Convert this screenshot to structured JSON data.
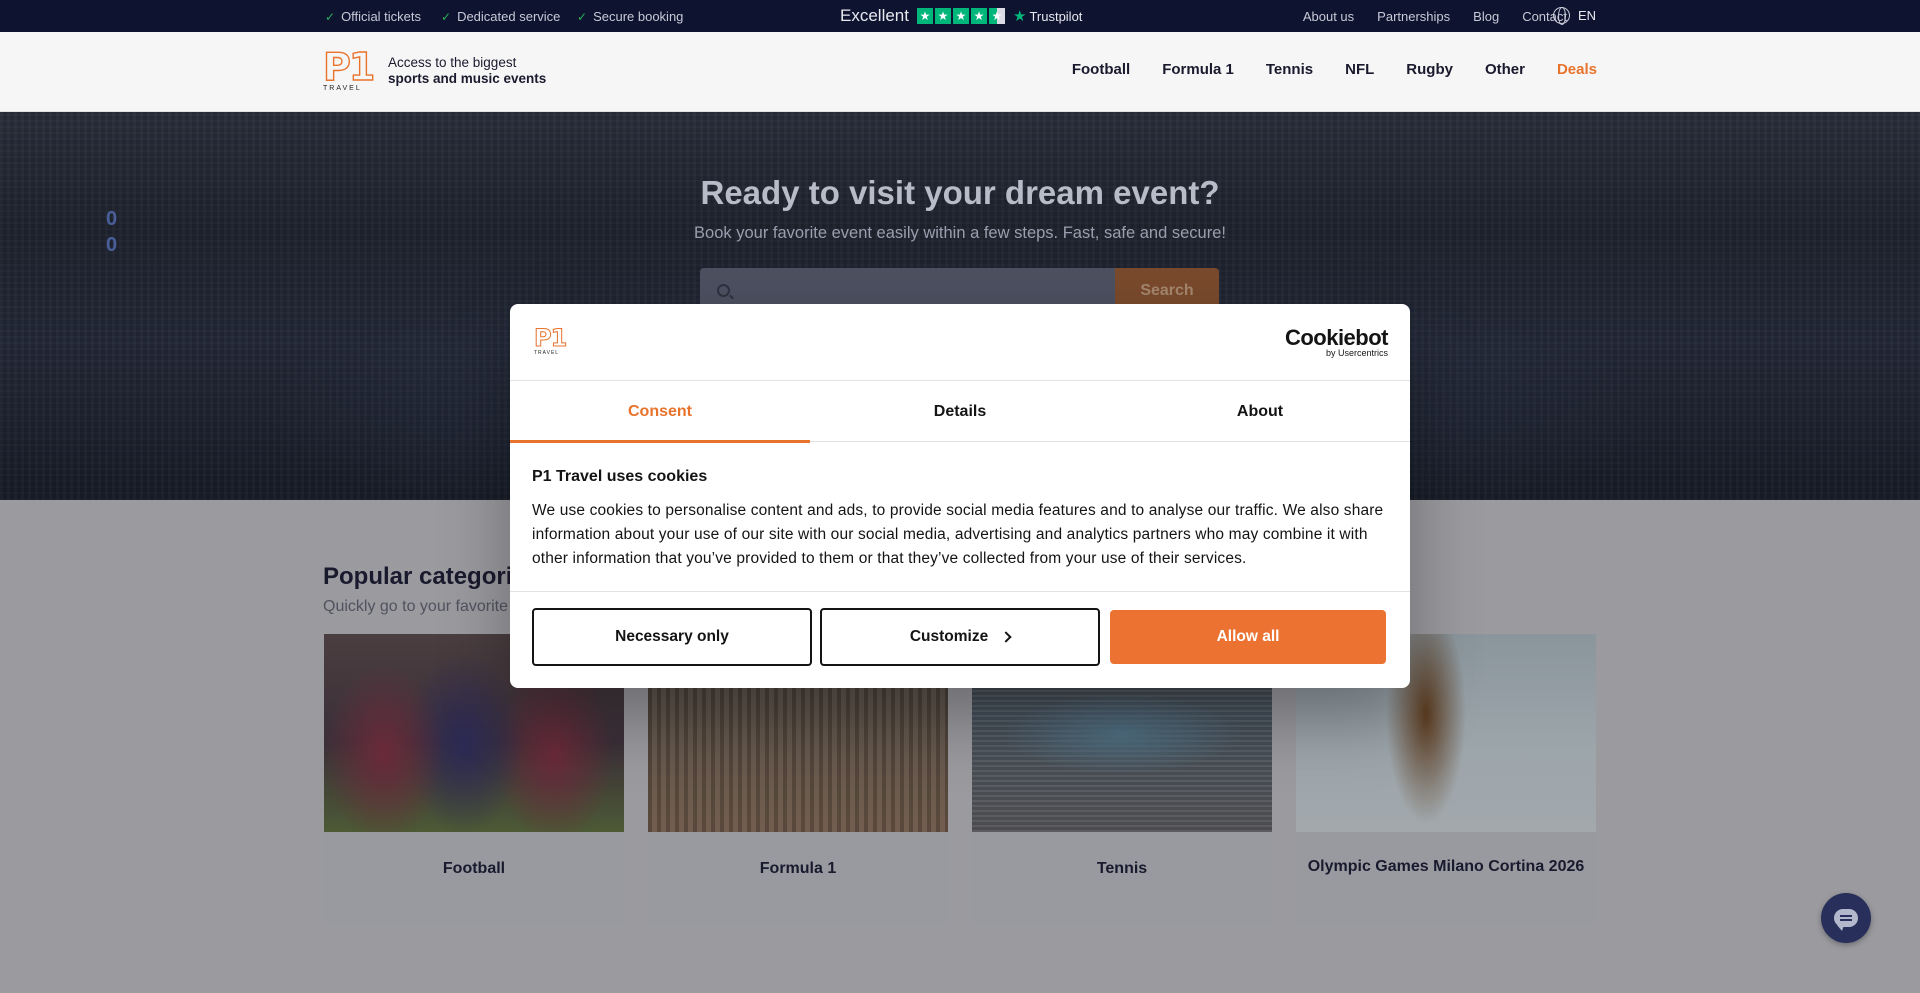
{
  "topbar": {
    "usps": [
      "Official tickets",
      "Dedicated service",
      "Secure booking"
    ],
    "trustpilot": {
      "rating_text": "Excellent",
      "brand": "Trustpilot",
      "stars": 4.5
    },
    "links": [
      "About us",
      "Partnerships",
      "Blog",
      "Contact"
    ],
    "language": "EN"
  },
  "header": {
    "logo_text": "P1",
    "logo_sub": "TRAVEL",
    "tagline_line1": "Access to the biggest",
    "tagline_line2": "sports and music events",
    "nav": [
      "Football",
      "Formula 1",
      "Tennis",
      "NFL",
      "Rugby",
      "Other",
      "Deals"
    ]
  },
  "hero": {
    "title": "Ready to visit your dream event?",
    "subtitle": "Book your favorite event easily within a few steps. Fast, safe and secure!",
    "search_placeholder": "",
    "search_button": "Search",
    "scoreboard": [
      "0",
      "0"
    ]
  },
  "categories": {
    "title": "Popular categories",
    "subtitle": "Quickly go to your favorite",
    "cards": [
      "Football",
      "Formula 1",
      "Tennis",
      "Olympic Games Milano Cortina 2026"
    ]
  },
  "cookie_dialog": {
    "provider": "Cookiebot",
    "provider_sub": "by Usercentrics",
    "tabs": [
      "Consent",
      "Details",
      "About"
    ],
    "active_tab": "Consent",
    "title": "P1 Travel uses cookies",
    "body": "We use cookies to personalise content and ads, to provide social media features and to analyse our traffic. We also share information about your use of our site with our social media, advertising and analytics partners who may combine it with other information that you’ve provided to them or that they’ve collected from your use of their services.",
    "buttons": {
      "necessary": "Necessary only",
      "customize": "Customize",
      "allow": "Allow all"
    }
  },
  "colors": {
    "accent": "#ec7231",
    "navy": "#0e1330",
    "trustpilot_green": "#00b67a"
  }
}
